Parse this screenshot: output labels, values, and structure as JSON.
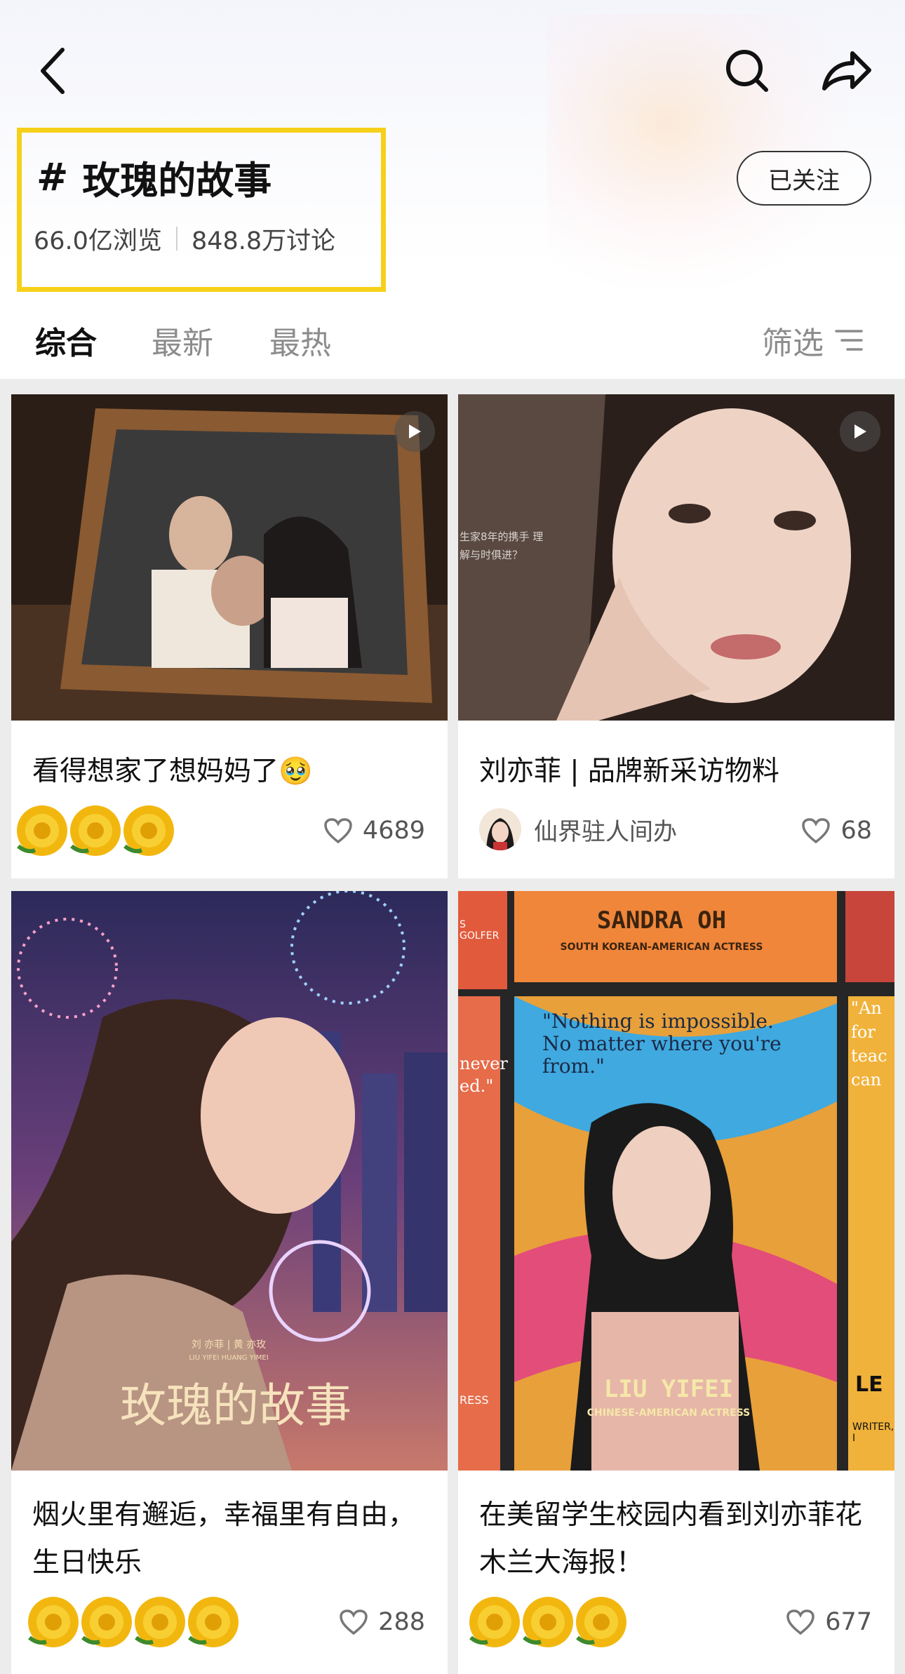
{
  "topic": {
    "hash": "#",
    "title": "玫瑰的故事",
    "views": "66.0亿浏览",
    "discussions": "848.8万讨论",
    "follow_label": "已关注"
  },
  "icons": {
    "back": "back-arrow-icon",
    "search": "search-icon",
    "share": "share-icon",
    "filter": "filter-icon",
    "like": "heart-icon",
    "play": "play-icon",
    "rose": "rose-sticker-icon"
  },
  "tabs": [
    {
      "label": "综合"
    },
    {
      "label": "最新"
    },
    {
      "label": "最热"
    }
  ],
  "filter_label": "筛选",
  "cards": [
    {
      "title": "看得想家了想妈妈了🥹",
      "likes": "4689"
    },
    {
      "title": "刘亦菲 | 品牌新采访物料",
      "author": "仙界驻人间办",
      "likes": "68"
    },
    {
      "title": "烟火里有邂逅，幸福里有自由，生日快乐",
      "likes": "288"
    },
    {
      "title": "在美留学生校园内看到刘亦菲花木兰大海报！",
      "likes": "677"
    }
  ],
  "image_text": {
    "card2_overlay": "生家8年的携手 理解与时俱进？",
    "card3_names": "刘 亦菲 | 黄 亦玫",
    "card3_pinyin": "LIU YIFEI   HUANG YIMEI",
    "card3_title": "玫瑰的故事",
    "card4_name_top": "SANDRA OH",
    "card4_role_top": "SOUTH KOREAN-AMERICAN ACTRESS",
    "card4_left_partial": "S GOLFER",
    "card4_quote": "\"Nothing is impossible. No matter where you're from.\"",
    "card4_left_quote": "never ed.\"",
    "card4_right_quote": "\"An for teac can",
    "card4_name": "LIU YIFEI",
    "card4_role": "CHINESE-AMERICAN ACTRESS",
    "card4_left_bottom": "RESS",
    "card4_right_name": "LE",
    "card4_right_role": "WRITER, I"
  },
  "colors": {
    "highlight": "#f6d01a",
    "background": "#ececec",
    "card": "#ffffff",
    "tab_inactive": "#8c8c8c"
  }
}
